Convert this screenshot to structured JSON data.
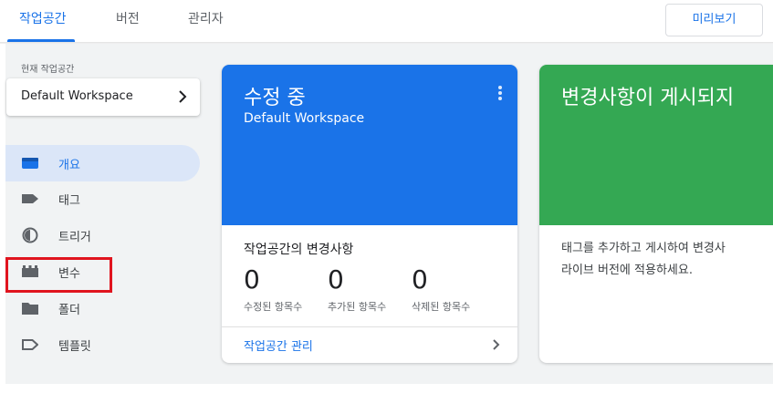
{
  "header": {
    "tabs": [
      {
        "label": "작업공간",
        "active": true
      },
      {
        "label": "버전",
        "active": false
      },
      {
        "label": "관리자",
        "active": false
      }
    ],
    "preview_label": "미리보기",
    "accent_color": "#1a73e8"
  },
  "sidebar": {
    "current_workspace_label": "현재 작업공간",
    "workspace_name": "Default Workspace",
    "items": [
      {
        "label": "개요",
        "icon": "overview-icon",
        "active": true
      },
      {
        "label": "태그",
        "icon": "tag-icon",
        "active": false
      },
      {
        "label": "트리거",
        "icon": "trigger-icon",
        "active": false
      },
      {
        "label": "변수",
        "icon": "variable-icon",
        "active": false,
        "highlighted": true
      },
      {
        "label": "폴더",
        "icon": "folder-icon",
        "active": false
      },
      {
        "label": "템플릿",
        "icon": "template-icon",
        "active": false
      }
    ]
  },
  "cards": {
    "editing": {
      "title": "수정 중",
      "subtitle": "Default Workspace",
      "changes_title": "작업공간의 변경사항",
      "stats": [
        {
          "value": "0",
          "caption": "수정된 항목수"
        },
        {
          "value": "0",
          "caption": "추가된 항목수"
        },
        {
          "value": "0",
          "caption": "삭제된 항목수"
        }
      ],
      "manage_link": "작업공간 관리",
      "color": "#1a73e8"
    },
    "publish": {
      "title": "변경사항이 게시되지",
      "body_line1": "태그를 추가하고 게시하여 변경사",
      "body_line2": "라이브 버전에 적용하세요.",
      "color": "#34a853"
    }
  }
}
